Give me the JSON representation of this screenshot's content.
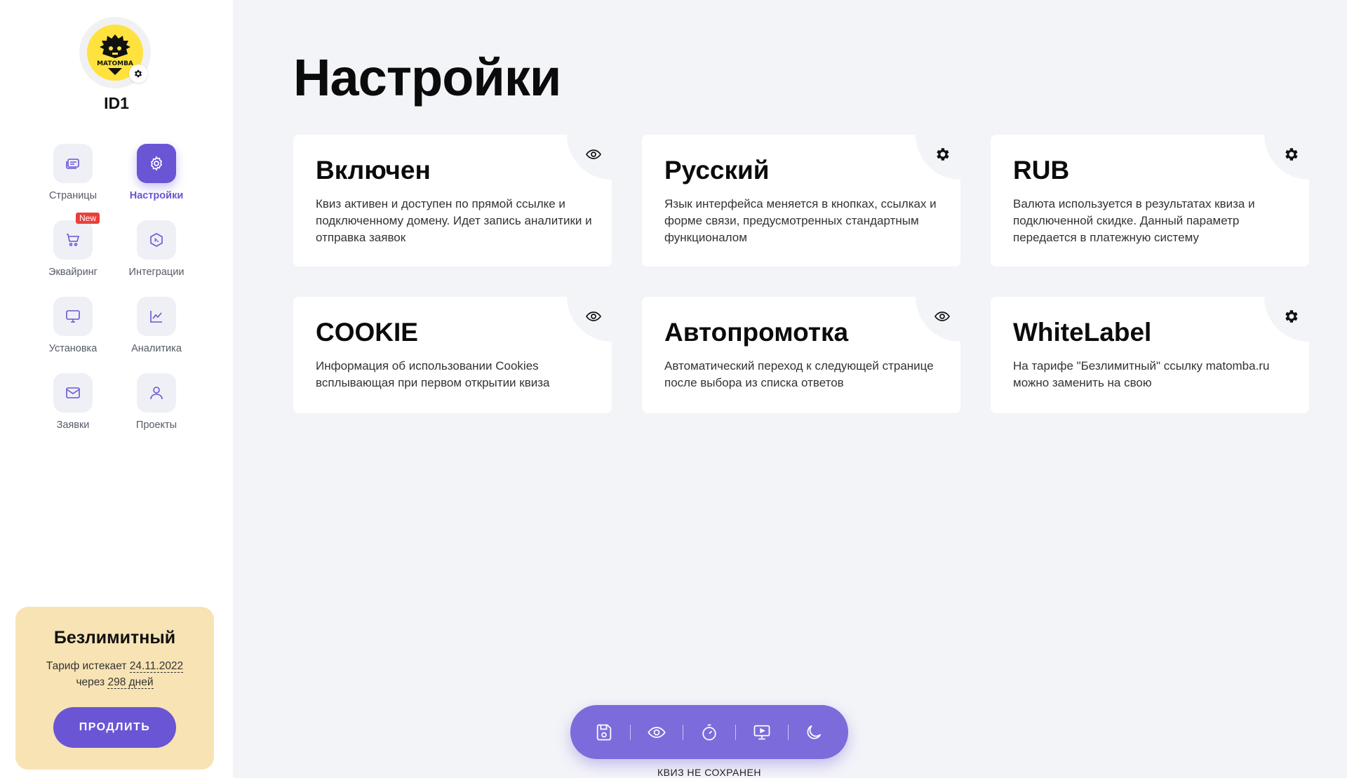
{
  "sidebar": {
    "user_id": "ID1",
    "avatar_label": "MATOMBA",
    "nav": [
      {
        "label": "Страницы",
        "icon": "pages-icon",
        "active": false
      },
      {
        "label": "Настройки",
        "icon": "gear-icon",
        "active": true
      },
      {
        "label": "Эквайринг",
        "icon": "cart-icon",
        "active": false,
        "badge": "New"
      },
      {
        "label": "Интеграции",
        "icon": "integrations-icon",
        "active": false
      },
      {
        "label": "Установка",
        "icon": "monitor-icon",
        "active": false
      },
      {
        "label": "Аналитика",
        "icon": "chart-icon",
        "active": false
      },
      {
        "label": "Заявки",
        "icon": "mail-icon",
        "active": false
      },
      {
        "label": "Проекты",
        "icon": "user-icon",
        "active": false
      }
    ],
    "plan": {
      "title": "Безлимитный",
      "expires_prefix": "Тариф истекает",
      "expires_date": "24.11.2022",
      "days_prefix": "через",
      "days_value": "298 дней",
      "button": "ПРОДЛИТЬ"
    }
  },
  "main": {
    "title": "Настройки",
    "cards": [
      {
        "title": "Включен",
        "desc": "Квиз активен и доступен по прямой ссылке и подключенному домену. Идет запись аналитики и отправка заявок",
        "icon": "eye-icon"
      },
      {
        "title": "Русский",
        "desc": "Язык интерфейса меняется в кнопках, ссылках и форме связи, предусмотренных стандартным функционалом",
        "icon": "gear-icon"
      },
      {
        "title": "RUB",
        "desc": "Валюта используется в результатах квиза и подключенной скидке. Данный параметр передается в платежную систему",
        "icon": "gear-icon"
      },
      {
        "title": "COOKIE",
        "desc": "Информация об использовании Cookies всплывающая при первом открытии квиза",
        "icon": "eye-icon"
      },
      {
        "title": "Автопромотка",
        "desc": "Автоматический переход к следующей странице после выбора из списка ответов",
        "icon": "eye-icon"
      },
      {
        "title": "WhiteLabel",
        "desc": "На тарифе \"Безлимитный\" ссылку matomba.ru можно заменить на свою",
        "icon": "gear-icon"
      }
    ]
  },
  "toolbar": {
    "buttons": [
      "save-icon",
      "eye-icon",
      "timer-icon",
      "presentation-icon",
      "moon-icon"
    ],
    "status": "КВИЗ НЕ СОХРАНЕН"
  },
  "colors": {
    "accent": "#6a55d4",
    "toolbar": "#7c6bdb",
    "plan_bg": "#f8e3b4",
    "page_bg": "#f3f4f8",
    "badge": "#e7413c"
  }
}
